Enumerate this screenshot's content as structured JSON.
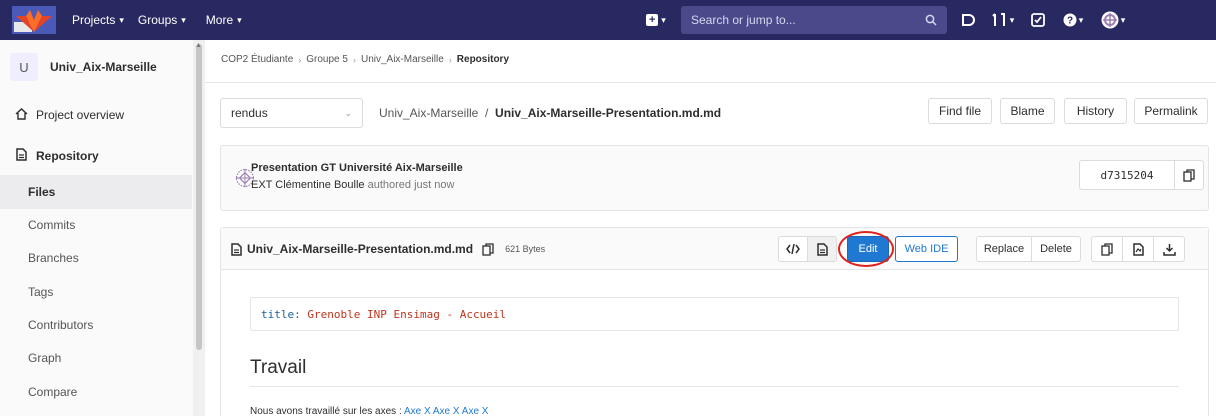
{
  "topbar": {
    "projects": "Projects",
    "groups": "Groups",
    "more": "More",
    "search_placeholder": "Search or jump to...",
    "brand_color": "#292961"
  },
  "sidebar": {
    "project_initial": "U",
    "project_name": "Univ_Aix-Marseille",
    "overview": "Project overview",
    "repository": "Repository",
    "items": [
      "Files",
      "Commits",
      "Branches",
      "Tags",
      "Contributors",
      "Graph",
      "Compare"
    ],
    "active": "Files"
  },
  "breadcrumb": [
    "COP2 Étudiante",
    "Groupe 5",
    "Univ_Aix-Marseille",
    "Repository"
  ],
  "toolbar": {
    "branch": "rendus",
    "path_dir": "Univ_Aix-Marseille",
    "path_sep": "/",
    "path_file": "Univ_Aix-Marseille-Presentation.md.md",
    "find_file": "Find file",
    "blame": "Blame",
    "history": "History",
    "permalink": "Permalink"
  },
  "commit": {
    "title": "Presentation GT Université Aix-Marseille",
    "author": "EXT Clémentine Boulle",
    "time": "authored just now",
    "sha": "d7315204"
  },
  "file": {
    "name": "Univ_Aix-Marseille-Presentation.md.md",
    "size": "621 Bytes",
    "edit": "Edit",
    "web_ide": "Web IDE",
    "replace": "Replace",
    "delete": "Delete"
  },
  "content": {
    "code_key": "title",
    "code_value": "Grenoble INP Ensimag - Accueil",
    "heading": "Travail",
    "para_text": "Nous avons travaillé sur les axes :",
    "para_links": "Axe X Axe X Axe X"
  },
  "colors": {
    "accent": "#1f78d1",
    "highlight_circle": "#e0201b"
  }
}
